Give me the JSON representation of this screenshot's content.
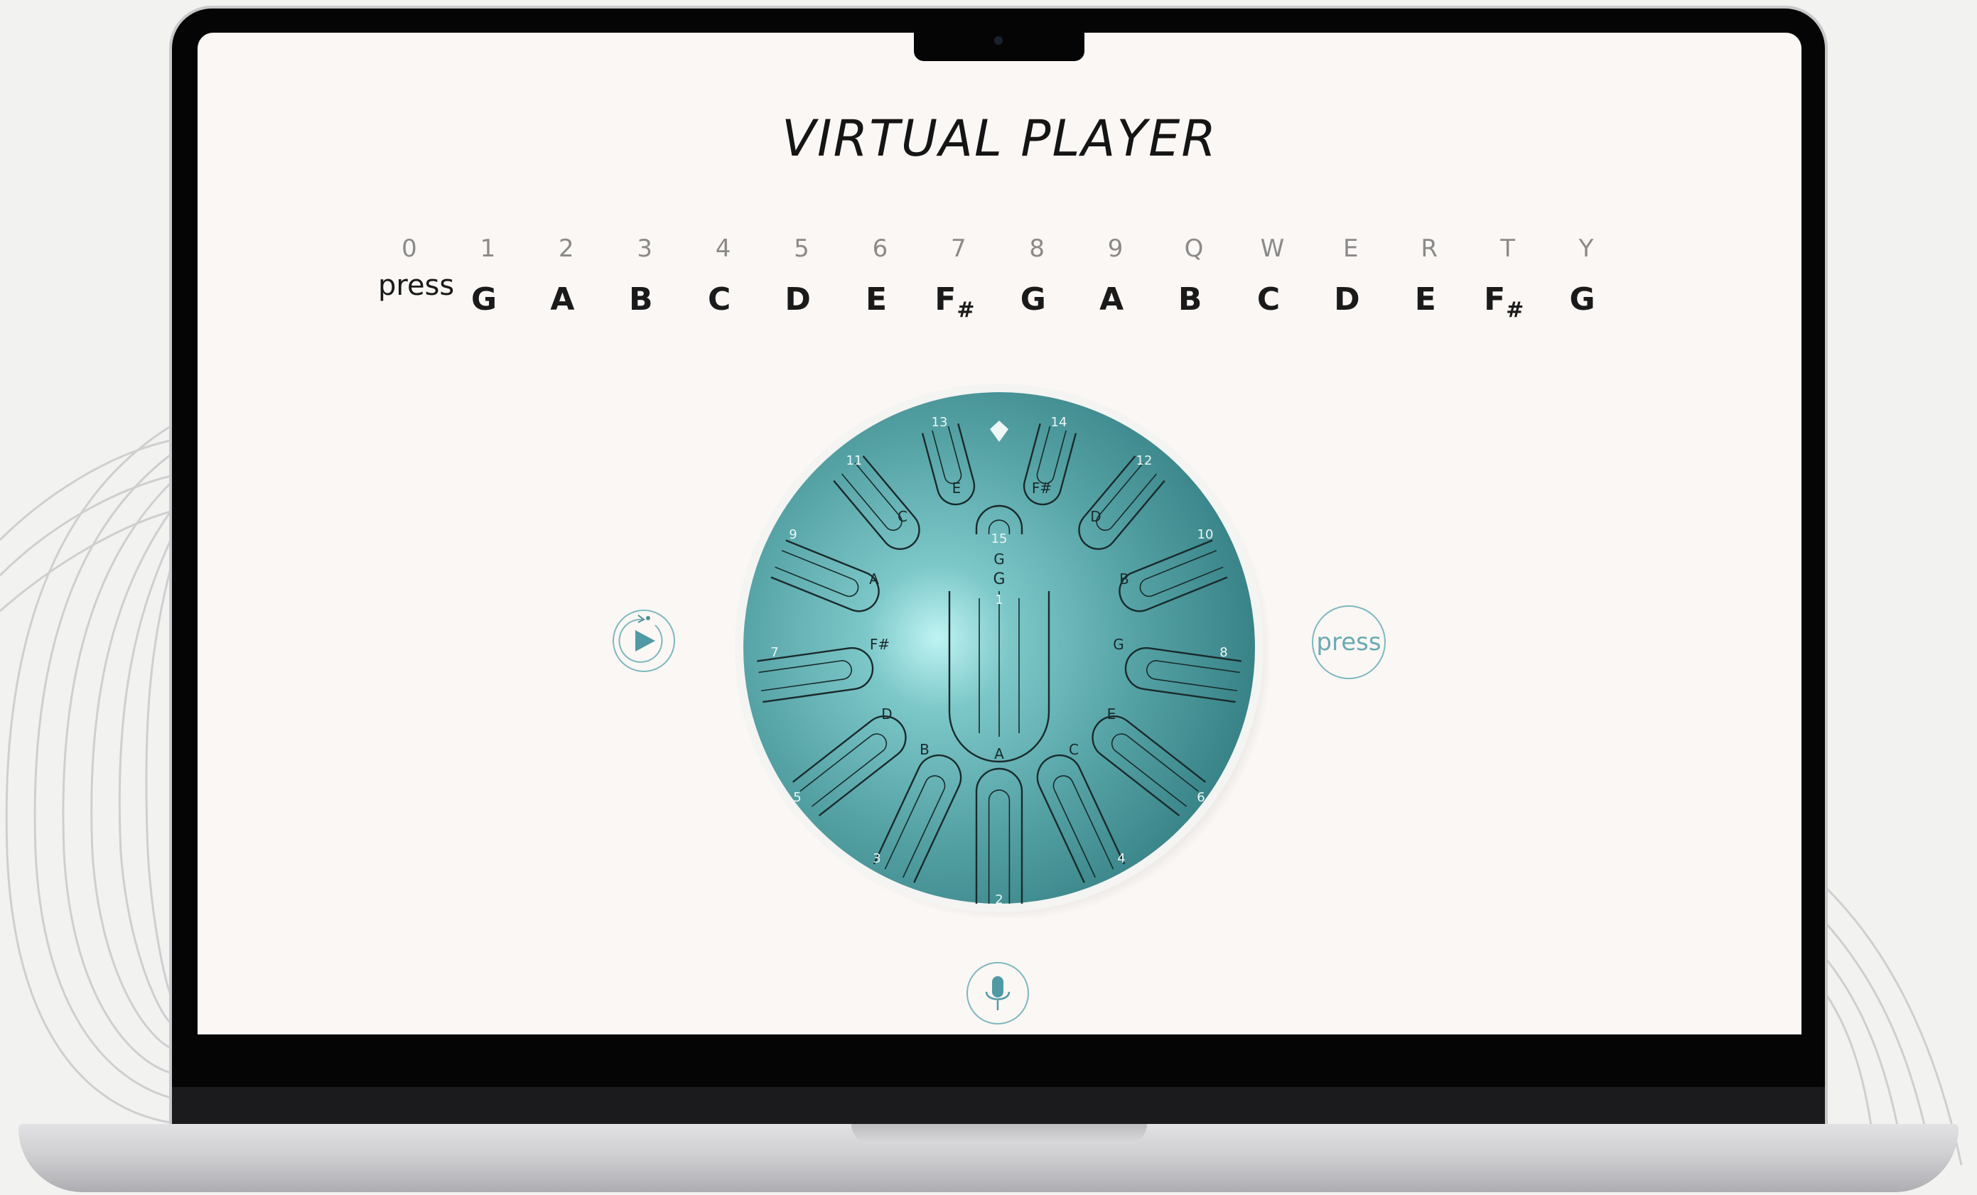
{
  "app": {
    "title": "VIRTUAL PLAYER"
  },
  "keyboard": {
    "press_label": "press",
    "keys": [
      "0",
      "1",
      "2",
      "3",
      "4",
      "5",
      "6",
      "7",
      "8",
      "9",
      "Q",
      "W",
      "E",
      "R",
      "T",
      "Y"
    ],
    "notes": [
      {
        "note": "G",
        "sharp": ""
      },
      {
        "note": "A",
        "sharp": ""
      },
      {
        "note": "B",
        "sharp": ""
      },
      {
        "note": "C",
        "sharp": ""
      },
      {
        "note": "D",
        "sharp": ""
      },
      {
        "note": "E",
        "sharp": ""
      },
      {
        "note": "F",
        "sharp": "#"
      },
      {
        "note": "G",
        "sharp": ""
      },
      {
        "note": "A",
        "sharp": ""
      },
      {
        "note": "B",
        "sharp": ""
      },
      {
        "note": "C",
        "sharp": ""
      },
      {
        "note": "D",
        "sharp": ""
      },
      {
        "note": "E",
        "sharp": ""
      },
      {
        "note": "F",
        "sharp": "#"
      },
      {
        "note": "G",
        "sharp": ""
      }
    ]
  },
  "controls": {
    "play_icon": "play-icon",
    "press_button_label": "press",
    "mic_icon": "microphone-icon"
  },
  "drum": {
    "tongues": [
      {
        "num": "1",
        "note": "G"
      },
      {
        "num": "2",
        "note": "A"
      },
      {
        "num": "3",
        "note": "B"
      },
      {
        "num": "4",
        "note": "C"
      },
      {
        "num": "5",
        "note": "D"
      },
      {
        "num": "6",
        "note": "E"
      },
      {
        "num": "7",
        "note": "F#"
      },
      {
        "num": "8",
        "note": "G"
      },
      {
        "num": "9",
        "note": "A"
      },
      {
        "num": "10",
        "note": "B"
      },
      {
        "num": "11",
        "note": "C"
      },
      {
        "num": "12",
        "note": "D"
      },
      {
        "num": "13",
        "note": "E"
      },
      {
        "num": "14",
        "note": "F#"
      },
      {
        "num": "15",
        "note": "G"
      }
    ],
    "colors": {
      "body": "#5aa7a9",
      "body_dark": "#347f83",
      "highlight": "#bff3f3",
      "rim": "#f4f4f2",
      "line": "#1a2a2b"
    }
  },
  "theme": {
    "screen_bg": "#fbf7f4",
    "accent": "#7db8c0"
  }
}
